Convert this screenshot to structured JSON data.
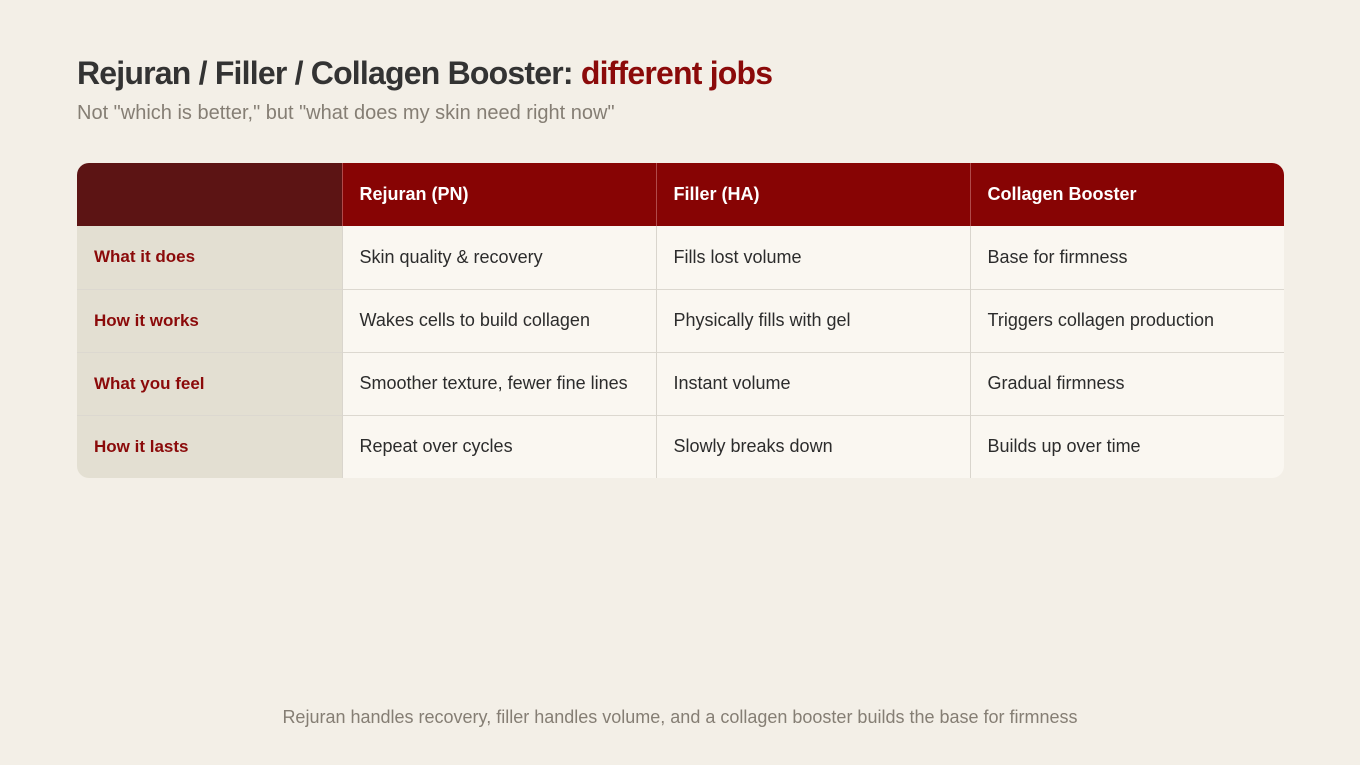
{
  "title": {
    "main": "Rejuran / Filler / Collagen Booster: ",
    "accent": "different jobs"
  },
  "subtitle": "Not \"which is better,\" but \"what does my skin need right now\"",
  "table": {
    "headers": [
      "",
      "Rejuran (PN)",
      "Filler (HA)",
      "Collagen Booster"
    ],
    "rows": [
      {
        "label": "What it does",
        "cells": [
          "Skin quality & recovery",
          "Fills lost volume",
          "Base for firmness"
        ]
      },
      {
        "label": "How it works",
        "cells": [
          "Wakes cells to build collagen",
          "Physically fills with gel",
          "Triggers collagen production"
        ]
      },
      {
        "label": "What you feel",
        "cells": [
          "Smoother texture, fewer fine lines",
          "Instant volume",
          "Gradual firmness"
        ]
      },
      {
        "label": "How it lasts",
        "cells": [
          "Repeat over cycles",
          "Slowly breaks down",
          "Builds up over time"
        ]
      }
    ]
  },
  "footer": "Rejuran handles recovery, filler handles volume, and a collagen booster builds the base for firmness",
  "colors": {
    "background": "#f3efe7",
    "accent": "#8b0a0a",
    "header_bg": "#870404",
    "corner_bg": "#5c1414",
    "label_col_bg": "#e3dfd2",
    "cell_bg": "#faf7f1",
    "muted_text": "#857e74"
  }
}
